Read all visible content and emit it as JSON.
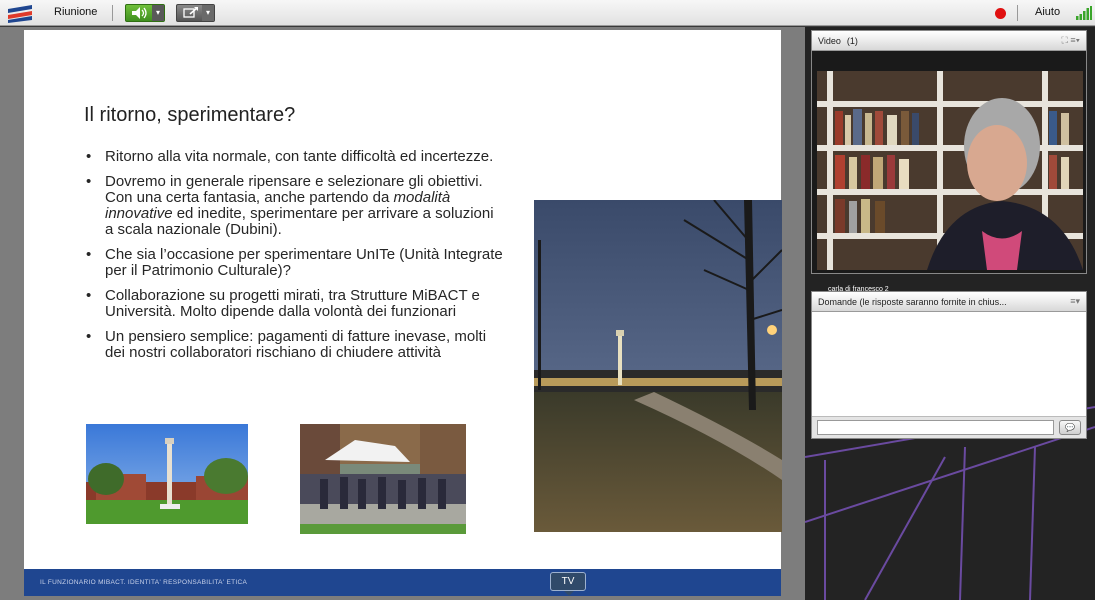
{
  "topbar": {
    "menu_label": "Riunione",
    "help_label": "Aiuto",
    "audio_caret": "▾",
    "share_caret": "▾"
  },
  "slide": {
    "title": "Il ritorno, sperimentare?",
    "bullets": [
      {
        "before": "Ritorno alla vita normale, con tante difficoltà ed incertezze.",
        "em": "",
        "after": ""
      },
      {
        "before": " Dovremo in generale ripensare e selezionare gli obiettivi. Con una certa fantasia, anche partendo da ",
        "em": "modalità innovative",
        "after": " ed inedite, sperimentare per arrivare a soluzioni a scala nazionale (Dubini)."
      },
      {
        "before": "Che sia l’occasione per sperimentare UnITe (Unità Integrate per il Patrimonio Culturale)?",
        "em": "",
        "after": ""
      },
      {
        "before": "Collaborazione su progetti mirati, tra Strutture MiBACT e Università. Molto dipende dalla volontà dei funzionari",
        "em": "",
        "after": ""
      },
      {
        "before": "Un pensiero semplice: pagamenti di fatture inevase, molti dei nostri collaboratori rischiano di chiudere attività",
        "em": "",
        "after": ""
      }
    ],
    "footer": "IL FUNZIONARIO MIBACT. IDENTITA' RESPONSABILITA' ETICA"
  },
  "tv_tab": "TV",
  "video_pod": {
    "title": "Video",
    "count": "(1)",
    "participant_name": "carla di francesco 2",
    "controls": "⛶   ≡▾"
  },
  "qa_pod": {
    "title": "Domande (le risposte saranno fornite in chius...",
    "controls": "≡▾",
    "send_icon": "💬"
  },
  "colors": {
    "slide_footer": "#1f4690",
    "audio_green": "#4fa52a",
    "record_red": "#e01010"
  }
}
